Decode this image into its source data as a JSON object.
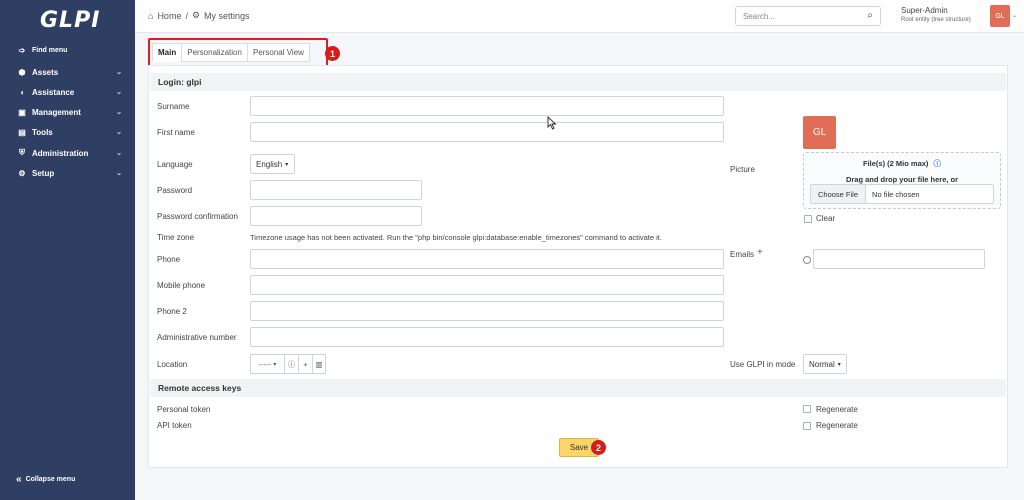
{
  "sidebar": {
    "logo": "GLPI",
    "find_menu": "Find menu",
    "items": [
      {
        "label": "Assets",
        "icon": "box-icon"
      },
      {
        "label": "Assistance",
        "icon": "headset-icon"
      },
      {
        "label": "Management",
        "icon": "wallet-icon"
      },
      {
        "label": "Tools",
        "icon": "briefcase-icon"
      },
      {
        "label": "Administration",
        "icon": "shield-icon"
      },
      {
        "label": "Setup",
        "icon": "gear-icon"
      }
    ],
    "collapse": "Collapse menu"
  },
  "header": {
    "breadcrumb_home": "Home",
    "breadcrumb_sep": "/",
    "breadcrumb_current": "My settings",
    "search_placeholder": "Search...",
    "user_name": "Super-Admin",
    "user_entity": "Root entity (tree structure)",
    "avatar_initials": "GL"
  },
  "tabs": [
    "Main",
    "Personalization",
    "Personal View"
  ],
  "badges": [
    "1",
    "2"
  ],
  "form": {
    "login_title": "Login: glpi",
    "surname_label": "Surname",
    "firstname_label": "First name",
    "language_label": "Language",
    "language_value": "English",
    "password_label": "Password",
    "password_confirm_label": "Password confirmation",
    "timezone_label": "Time zone",
    "timezone_text": "Timezone usage has not been activated. Run the \"php bin/console glpi:database:enable_timezones\" command to activate it.",
    "phone_label": "Phone",
    "mobile_label": "Mobile phone",
    "phone2_label": "Phone 2",
    "admin_number_label": "Administrative number",
    "location_label": "Location",
    "location_value": "-----",
    "picture_label": "Picture",
    "picture_initials": "GL",
    "files_title": "File(s) (2 Mio max)",
    "drag_text": "Drag and drop your file here, or",
    "choose_file": "Choose File",
    "no_file": "No file chosen",
    "clear_label": "Clear",
    "emails_label": "Emails",
    "glpi_mode_label": "Use GLPI in mode",
    "glpi_mode_value": "Normal",
    "remote_keys_title": "Remote access keys",
    "personal_token_label": "Personal token",
    "api_token_label": "API token",
    "regenerate_label": "Regenerate",
    "save_label": "Save"
  },
  "colors": {
    "sidebar_bg": "#2f3f64",
    "avatar": "#e06d55",
    "save_button": "#fbd46a",
    "annotation_red": "#e31b1b"
  }
}
